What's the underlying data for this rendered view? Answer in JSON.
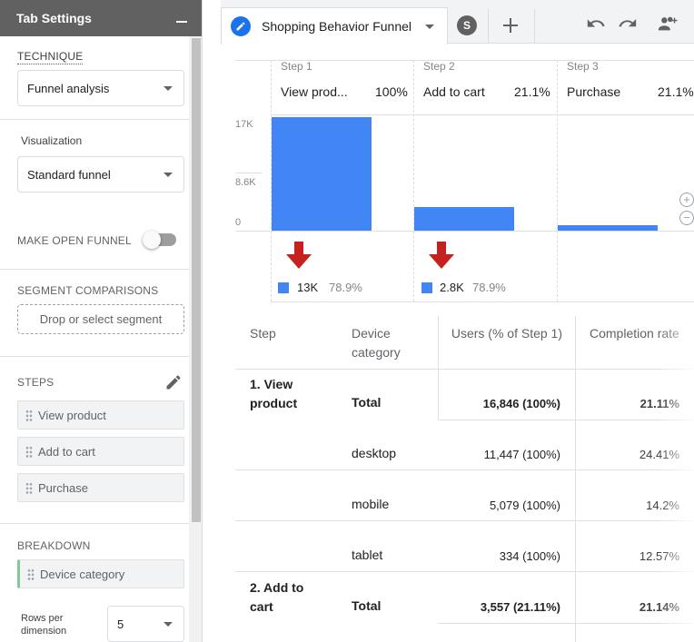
{
  "panel": {
    "title": "Tab Settings",
    "technique_label": "TECHNIQUE",
    "technique_value": "Funnel analysis",
    "visualization_label": "Visualization",
    "visualization_value": "Standard funnel",
    "open_funnel_label": "MAKE OPEN FUNNEL",
    "open_funnel_on": false,
    "segment_label": "SEGMENT COMPARISONS",
    "segment_placeholder": "Drop or select segment",
    "steps_label": "STEPS",
    "steps": [
      "View product",
      "Add to cart",
      "Purchase"
    ],
    "breakdown_label": "BREAKDOWN",
    "breakdown_value": "Device category",
    "rows_label_1": "Rows per",
    "rows_label_2": "dimension",
    "rows_value": "5"
  },
  "tabs": {
    "active_title": "Shopping Behavior Funnel",
    "avatar_letter": "S"
  },
  "colors": {
    "bar": "#4285f4",
    "arrow": "#c5221f",
    "header": "#616161",
    "accent": "#1a73e8"
  },
  "chart_data": {
    "type": "bar",
    "categories": [
      "View product",
      "Add to cart",
      "Purchase"
    ],
    "step_labels": [
      "Step 1",
      "Step 2",
      "Step 3"
    ],
    "display_names": [
      "View prod...",
      "Add to cart",
      "Purchase"
    ],
    "step_pcts": [
      "100%",
      "21.1%",
      "21.1%"
    ],
    "values": [
      16846,
      3557,
      751
    ],
    "ylim": [
      0,
      17000
    ],
    "yticks": [
      "17K",
      "8.6K",
      "0"
    ],
    "abandon": [
      {
        "value": "13K",
        "pct": "78.9%"
      },
      {
        "value": "2.8K",
        "pct": "78.9%"
      }
    ]
  },
  "table": {
    "headers": {
      "step": "Step",
      "device": "Device category",
      "users": "Users (% of Step 1)",
      "completion": "Completion rate"
    },
    "rows": [
      {
        "step": "1. View product",
        "device": "Total",
        "users": "16,846 (100%)",
        "rate": "21.11%"
      },
      {
        "step": "",
        "device": "desktop",
        "users": "11,447 (100%)",
        "rate": "24.41%"
      },
      {
        "step": "",
        "device": "mobile",
        "users": "5,079 (100%)",
        "rate": "14.2%"
      },
      {
        "step": "",
        "device": "tablet",
        "users": "334 (100%)",
        "rate": "12.57%"
      },
      {
        "step": "2. Add to cart",
        "device": "Total",
        "users": "3,557 (21.11%)",
        "rate": "21.14%"
      }
    ]
  }
}
